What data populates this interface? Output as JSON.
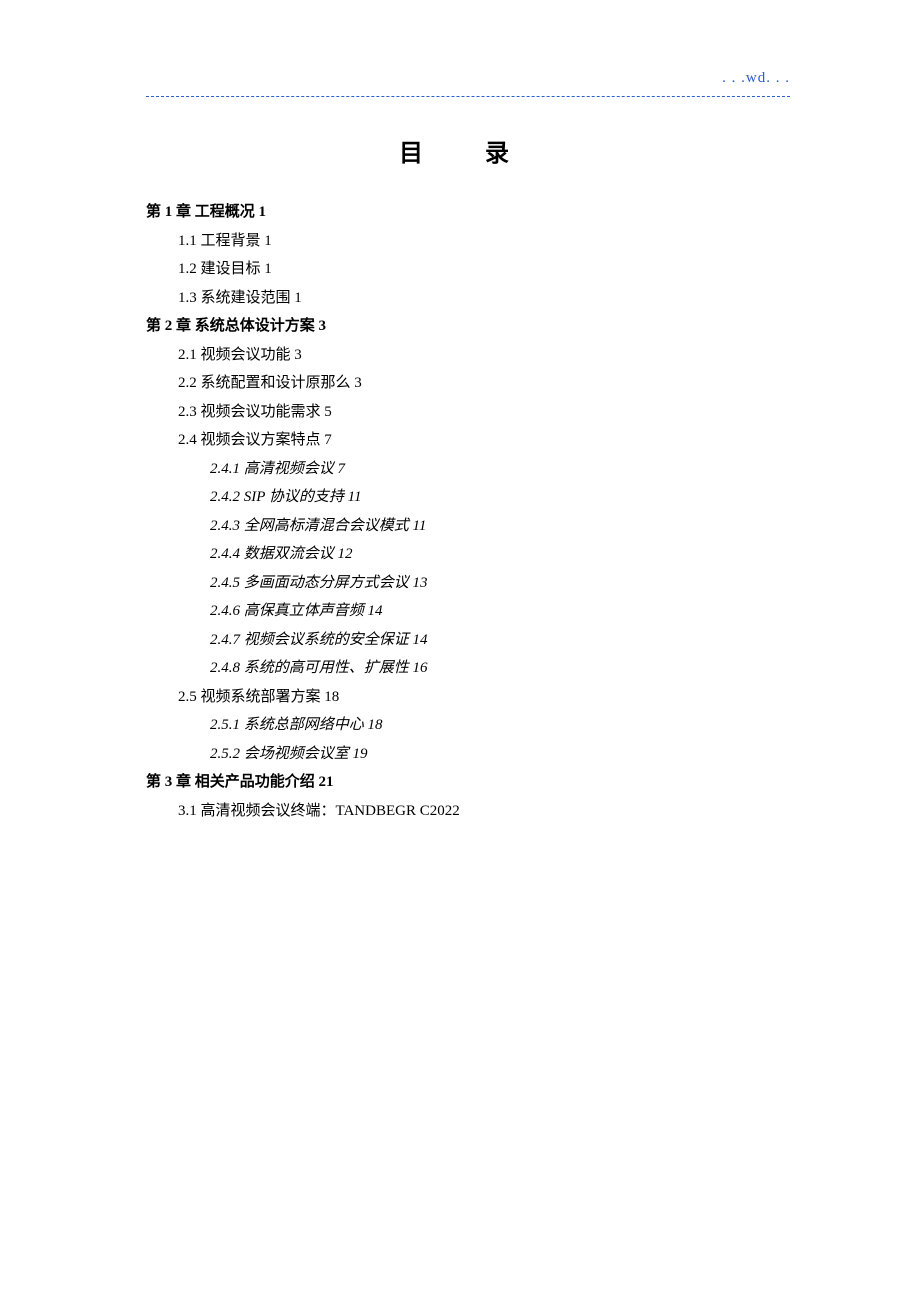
{
  "header": {
    "watermark": ". . .wd. . ."
  },
  "title": "目 录",
  "toc": [
    {
      "level": "ch",
      "text": "第 1 章  工程概况 1"
    },
    {
      "level": "sec",
      "text": "1.1  工程背景 1"
    },
    {
      "level": "sec",
      "text": "1.2  建设目标 1"
    },
    {
      "level": "sec",
      "text": "1.3  系统建设范围 1"
    },
    {
      "level": "ch",
      "text": "第 2 章  系统总体设计方案 3"
    },
    {
      "level": "sec",
      "text": "2.1  视频会议功能 3"
    },
    {
      "level": "sec",
      "text": "2.2  系统配置和设计原那么 3"
    },
    {
      "level": "sec",
      "text": "2.3  视频会议功能需求 5"
    },
    {
      "level": "sec",
      "text": "2.4  视频会议方案特点 7"
    },
    {
      "level": "sub",
      "text": "2.4.1  高清视频会议 7"
    },
    {
      "level": "sub",
      "text": "2.4.2 SIP 协议的支持 11"
    },
    {
      "level": "sub",
      "text": "2.4.3  全网高标清混合会议模式 11"
    },
    {
      "level": "sub",
      "text": "2.4.4  数据双流会议 12"
    },
    {
      "level": "sub",
      "text": "2.4.5  多画面动态分屏方式会议 13"
    },
    {
      "level": "sub",
      "text": "2.4.6  高保真立体声音频 14"
    },
    {
      "level": "sub",
      "text": "2.4.7  视频会议系统的安全保证 14"
    },
    {
      "level": "sub",
      "text": "2.4.8  系统的高可用性、扩展性 16"
    },
    {
      "level": "sec",
      "text": "2.5  视频系统部署方案 18"
    },
    {
      "level": "sub",
      "text": "2.5.1  系统总部网络中心 18"
    },
    {
      "level": "sub",
      "text": "2.5.2  会场视频会议室 19"
    },
    {
      "level": "ch",
      "text": "第 3 章  相关产品功能介绍 21"
    },
    {
      "level": "sec",
      "text": "3.1  高清视频会议终端：TANDBEGR C2022"
    }
  ]
}
